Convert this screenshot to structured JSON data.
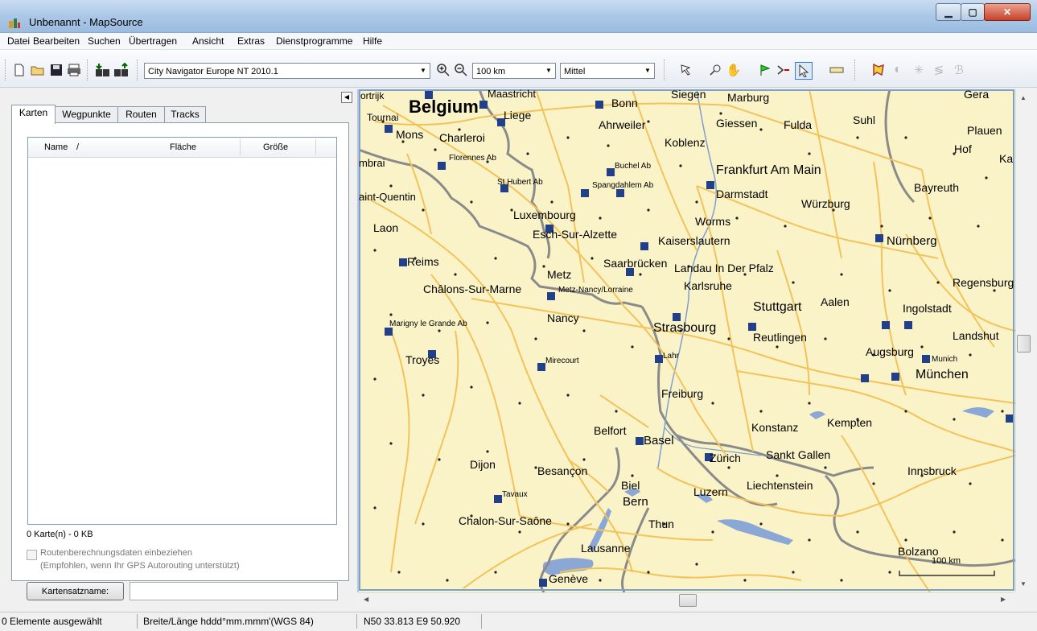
{
  "window": {
    "title": "Unbenannt - MapSource"
  },
  "menu": [
    "Datei",
    "Bearbeiten",
    "Suchen",
    "Übertragen",
    "Ansicht",
    "Extras",
    "Dienstprogramme",
    "Hilfe"
  ],
  "toolbar": {
    "map_product": "City Navigator Europe NT 2010.1",
    "zoom_level": "100 km",
    "detail_level": "Mittel"
  },
  "left_panel": {
    "tabs": [
      "Karten",
      "Wegpunkte",
      "Routen",
      "Tracks"
    ],
    "columns": [
      "Name",
      "Fläche",
      "Größe"
    ],
    "sort_indicator": "/",
    "map_count": "0 Karte(n) - 0 KB",
    "checkbox_label_line1": "Routenberechnungsdaten einbeziehen",
    "checkbox_label_line2": "(Empfohlen, wenn Ihr GPS Autorouting unterstützt)",
    "setname_button": "Kartensatzname:",
    "setname_value": ""
  },
  "map": {
    "scale_label": "100 km",
    "labels": {
      "belgium": "Belgium",
      "maastricht": "Maastricht",
      "bonn": "Bonn",
      "siegen": "Siegen",
      "marburg": "Marburg",
      "gera": "Gera",
      "kortrijk": "ortrijk",
      "tournai": "Tournai",
      "liege": "Liege",
      "ahrweiler": "Ahrweiler",
      "giessen": "Giessen",
      "fulda": "Fulda",
      "suhl": "Suhl",
      "plauen": "Plauen",
      "mons": "Mons",
      "charleroi": "Charleroi",
      "koblenz": "Koblenz",
      "hof": "Hof",
      "ka": "Ka",
      "cambrai": "mbrai",
      "florennes": "Florennes Ab",
      "buchel": "Buchel Ab",
      "frankfurt": "Frankfurt Am Main",
      "st_hubert": "St Hubert Ab",
      "spangdahlem": "Spangdahlem Ab",
      "darmstadt": "Darmstadt",
      "bayreuth": "Bayreuth",
      "saint_quentin": "aint-Quentin",
      "wurzburg": "Würzburg",
      "luxembourg": "Luxembourg",
      "worms": "Worms",
      "laon": "Laon",
      "esch": "Esch-Sur-Alzette",
      "kaiserslautern": "Kaiserslautern",
      "nurnberg": "Nürnberg",
      "reims": "Reims",
      "saarbrucken": "Saarbrücken",
      "landau": "Landau In Der Pfalz",
      "metz": "Metz",
      "karlsruhe": "Karlsruhe",
      "regensburg": "Regensburg",
      "chalons": "Châlons-Sur-Marne",
      "metz_nancy": "Metz-Nancy/Lorraine",
      "aalen": "Aalen",
      "stuttgart": "Stuttgart",
      "ingolstadt": "Ingolstadt",
      "nancy": "Nancy",
      "marigny": "Marigny le Grande Ab",
      "strasbourg": "Strasbourg",
      "reutlingen": "Reutlingen",
      "landshut": "Landshut",
      "troyes": "Troyes",
      "mirecourt": "Mirecourt",
      "lahr": "Lahr",
      "augsburg": "Augsburg",
      "munich": "Munich",
      "munchen": "München",
      "freiburg": "Freiburg",
      "konstanz": "Konstanz",
      "kempten": "Kempten",
      "belfort": "Belfort",
      "basel": "Basel",
      "zurich": "Zürich",
      "sankt_gallen": "Sankt Gallen",
      "dijon": "Dijon",
      "besancon": "Besançon",
      "innsbruck": "Innsbruck",
      "biel": "Biel",
      "liechtenstein": "Liechtenstein",
      "tavaux": "Tavaux",
      "luzern": "Luzern",
      "bern": "Bern",
      "chalon": "Chalon-Sur-Saône",
      "thun": "Thun",
      "lausanne": "Lausanne",
      "bolzano": "Bolzano",
      "geneve": "Genève"
    }
  },
  "status": {
    "selection": "0 Elemente ausgewählt",
    "coord_format": "Breite/Länge hddd°mm.mmm'(WGS 84)",
    "position": "N50 33.813 E9 50.920"
  },
  "colors": {
    "map_bg": "#fbf3c8",
    "road": "#f2c35a",
    "border": "#8a8a8a",
    "water": "#8aa7d6"
  }
}
